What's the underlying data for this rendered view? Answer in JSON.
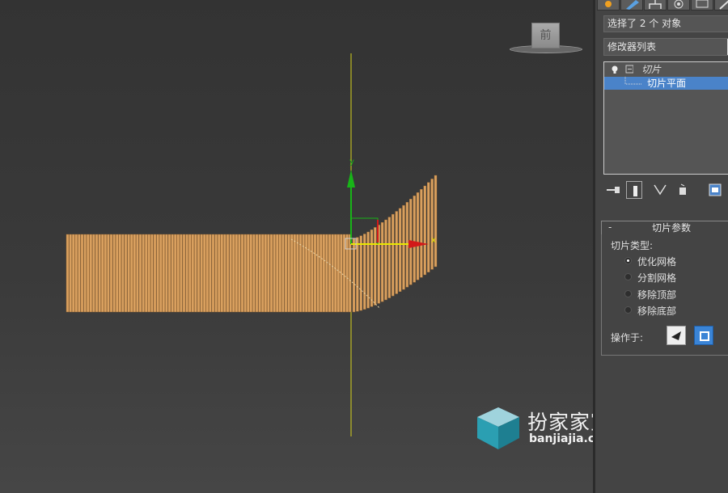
{
  "viewport": {
    "viewcube_label": "前",
    "gizmo_y_label": "y",
    "gizmo_x_label": "x",
    "watermark_title": "扮家家室内设计",
    "watermark_site": "banjiajia.com",
    "fence_color": "#d9a05f",
    "axis_line_color": "#d6d21c"
  },
  "panel": {
    "command_tabs": [
      "create-icon",
      "modify-icon",
      "hierarchy-icon",
      "motion-icon",
      "display-icon",
      "utilities-icon"
    ],
    "selection_field": "选择了 2 个 对象",
    "modifier_list": "修改器列表",
    "stack": {
      "modifier": "切片",
      "sub_object": "切片平面"
    },
    "stack_tools": [
      "pin-stack-icon",
      "show-end-result-icon",
      "make-unique-icon",
      "remove-modifier-icon",
      "configure-sets-icon"
    ],
    "rollout": {
      "title": "切片参数",
      "collapse": "-",
      "slice_type_label": "切片类型:",
      "options": [
        {
          "label": "优化网格",
          "selected": true
        },
        {
          "label": "分割网格",
          "selected": false
        },
        {
          "label": "移除顶部",
          "selected": false
        },
        {
          "label": "移除底部",
          "selected": false
        }
      ],
      "operate_on_label": "操作于:",
      "operate_on_selected": "polygon"
    }
  }
}
